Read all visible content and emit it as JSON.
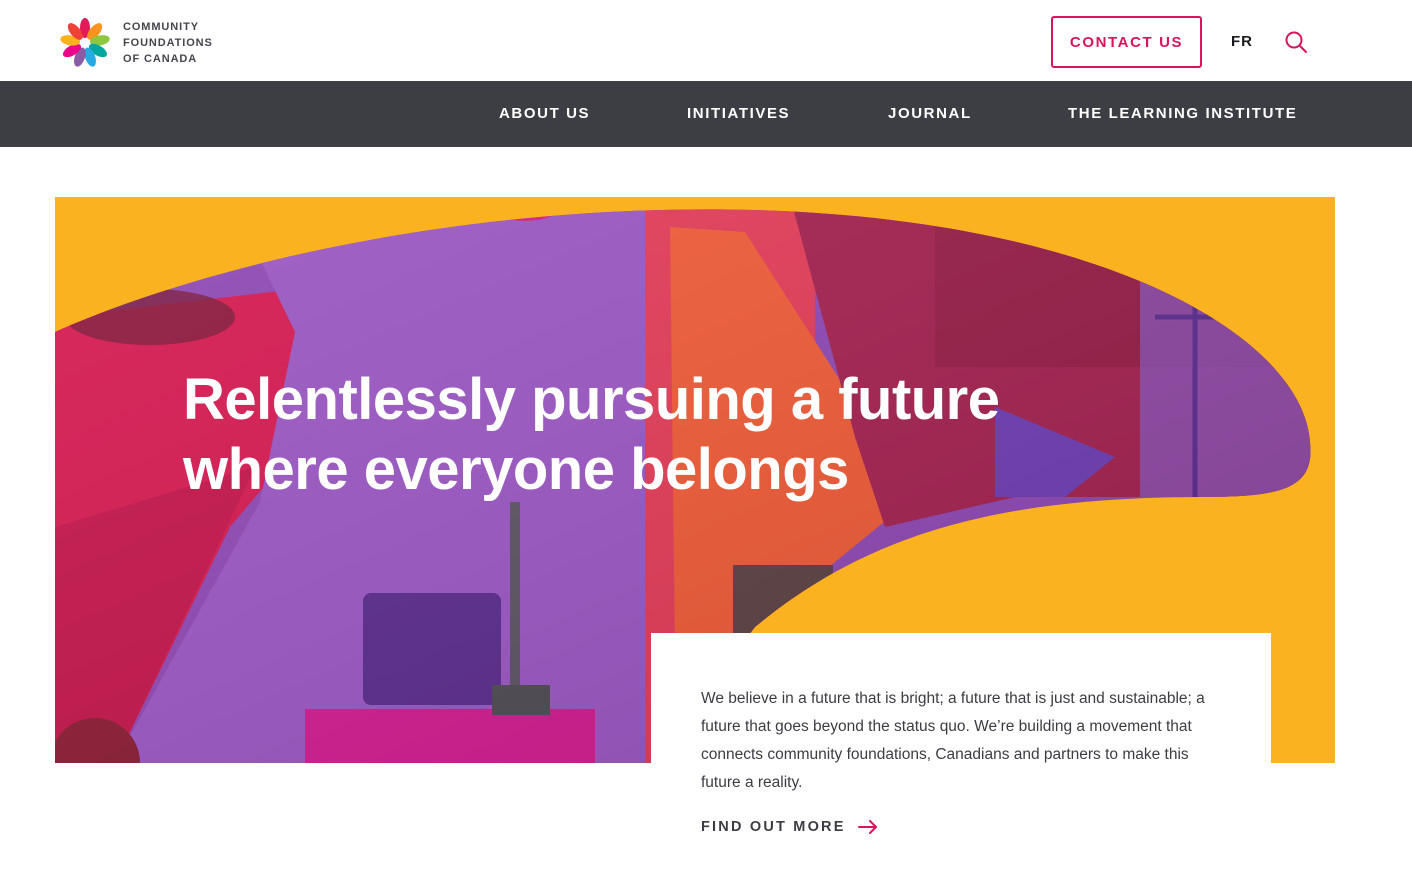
{
  "brand": {
    "logo_lines": [
      "COMMUNITY",
      "FOUNDATIONS",
      "OF CANADA"
    ],
    "accent_color": "#d6155c",
    "nav_bg": "#3d3e43",
    "hero_bg": "#fbb221"
  },
  "header": {
    "contact_label": "CONTACT US",
    "language_label": "FR",
    "search_icon": "search-icon"
  },
  "nav": {
    "items": [
      "ABOUT US",
      "INITIATIVES",
      "JOURNAL",
      "THE LEARNING INSTITUTE"
    ]
  },
  "hero": {
    "title_lines": [
      "Relentlessly pursuing a future",
      "where everyone belongs"
    ],
    "body": "We believe in a future that is bright; a future that is just and sustainable; a future that goes beyond the status quo. We’re building a movement that connects community foundations, Canadians and partners to make this future a reality.",
    "cta_label": "FIND OUT MORE",
    "cta_icon": "arrow-right-icon"
  }
}
